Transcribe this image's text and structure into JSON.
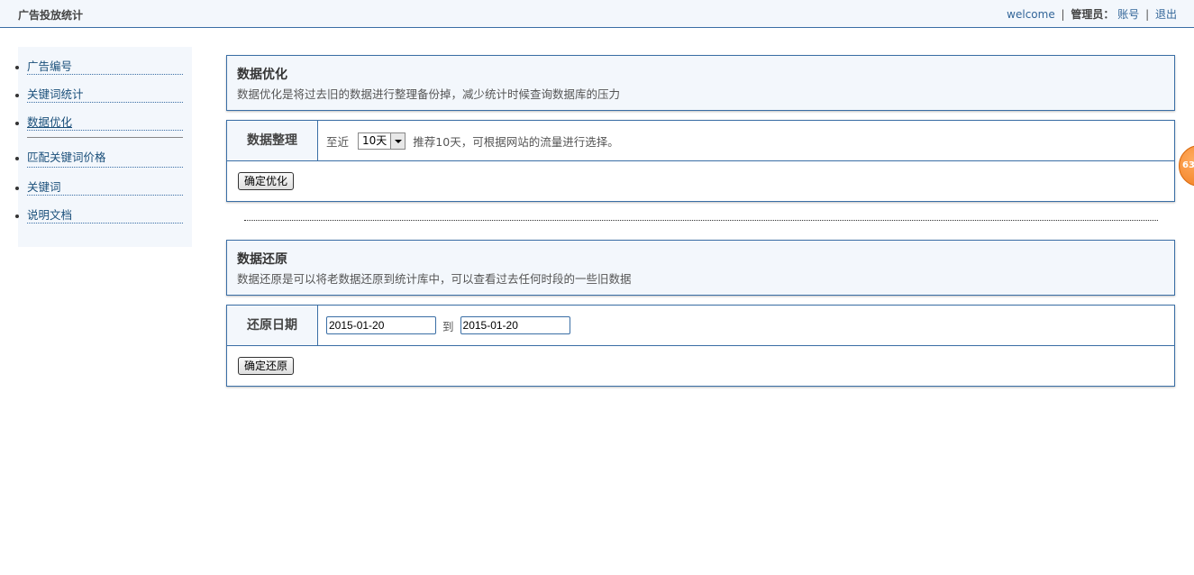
{
  "header": {
    "site_title": "广告投放统计",
    "welcome": "welcome",
    "role": "管理员：",
    "account_link": "账号",
    "logout_link": "退出",
    "separator": "|"
  },
  "sidebar": {
    "group1": [
      {
        "label": "广告编号"
      },
      {
        "label": "关键词统计"
      },
      {
        "label": "数据优化",
        "active": true
      }
    ],
    "group2": [
      {
        "label": "匹配关键词价格"
      },
      {
        "label": "关键词"
      },
      {
        "label": "说明文档"
      }
    ]
  },
  "optimize": {
    "title": "数据优化",
    "description": "数据优化是将过去旧的数据进行整理备份掉，减少统计时候查询数据库的压力",
    "label": "数据整理",
    "prefix": "至近",
    "select_value": "10天",
    "hint": "推荐10天，可根据网站的流量进行选择。",
    "button": "确定优化"
  },
  "restore": {
    "title": "数据还原",
    "description": "数据还原是可以将老数据还原到统计库中，可以查看过去任何时段的一些旧数据",
    "label": "还原日期",
    "start_date": "2015-01-20",
    "to_text": "到",
    "end_date": "2015-01-20",
    "button": "确定还原"
  },
  "floating_badge": "63",
  "colors": {
    "accent": "#3a6ea5",
    "panel_bg": "#f3f7fc",
    "link": "#1a4f7a",
    "badge": "#f07a1a"
  }
}
